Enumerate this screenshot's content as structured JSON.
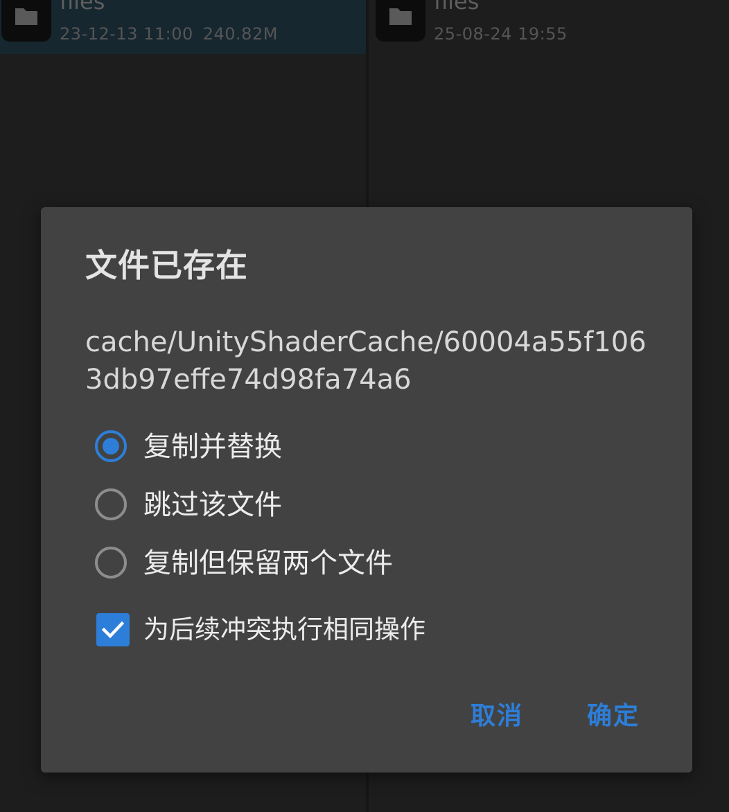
{
  "left_pane": {
    "file": {
      "name": "files",
      "date": "23-12-13 11:00",
      "size": "240.82M",
      "icon": "folder-icon"
    }
  },
  "right_pane": {
    "file": {
      "name": "files",
      "date": "25-08-24 19:55",
      "icon": "folder-icon"
    }
  },
  "dialog": {
    "title": "文件已存在",
    "path": "cache/UnityShaderCache/60004a55f1063db97effe74d98fa74a6",
    "options": [
      {
        "label": "复制并替换",
        "selected": true
      },
      {
        "label": "跳过该文件",
        "selected": false
      },
      {
        "label": "复制但保留两个文件",
        "selected": false
      }
    ],
    "apply_all": {
      "label": "为后续冲突执行相同操作",
      "checked": true
    },
    "buttons": {
      "cancel": "取消",
      "ok": "确定"
    }
  },
  "colors": {
    "accent": "#2d7ed8",
    "dialog_bg": "#424242",
    "screen_bg": "#1c1c1c",
    "selected_row": "#162730"
  }
}
